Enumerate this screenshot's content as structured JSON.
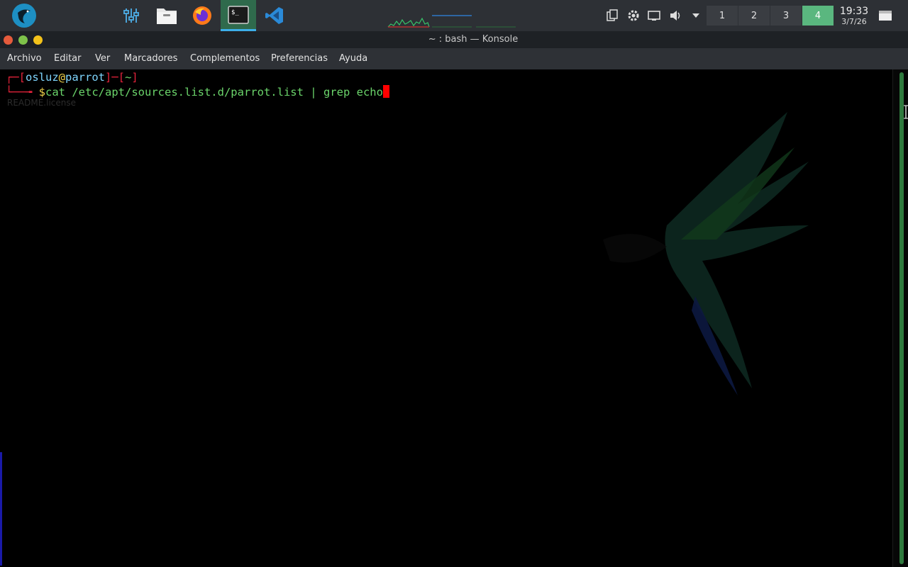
{
  "panel": {
    "launchers": [
      {
        "name": "app-menu-icon"
      },
      {
        "name": "settings-sliders-icon"
      },
      {
        "name": "file-manager-icon"
      },
      {
        "name": "firefox-icon"
      },
      {
        "name": "terminal-icon"
      },
      {
        "name": "vscode-icon"
      }
    ],
    "active_launcher": "terminal-icon",
    "tray_icons": [
      "clipboard-icon",
      "settings-gear-icon",
      "network-icon",
      "volume-icon",
      "tray-expand-icon"
    ],
    "pager": [
      {
        "label": "1",
        "active": false
      },
      {
        "label": "2",
        "active": false
      },
      {
        "label": "3",
        "active": false
      },
      {
        "label": "4",
        "active": true
      }
    ],
    "clock": {
      "time": "19:33",
      "date": "3/7/26"
    }
  },
  "window": {
    "title": "~ : bash — Konsole",
    "buttons": [
      "close",
      "minimize",
      "maximize"
    ]
  },
  "menubar": {
    "items": [
      "Archivo",
      "Editar",
      "Ver",
      "Marcadores",
      "Complementos",
      "Preferencias",
      "Ayuda"
    ]
  },
  "terminal": {
    "prompt": {
      "user": "osluz",
      "at": "@",
      "host": "parrot",
      "dir": "~",
      "symbol": "$"
    },
    "command": "cat /etc/apt/sources.list.d/parrot.list | grep echo",
    "hint": "README.license"
  },
  "colors": {
    "panel_bg": "#2d3035",
    "active_green": "#5ab77f",
    "prompt_red": "#e6233b",
    "prompt_cyan": "#7fd6ff",
    "prompt_yellow": "#f1d44b",
    "command_green": "#6bd56b",
    "cursor_red": "#ff0000"
  }
}
